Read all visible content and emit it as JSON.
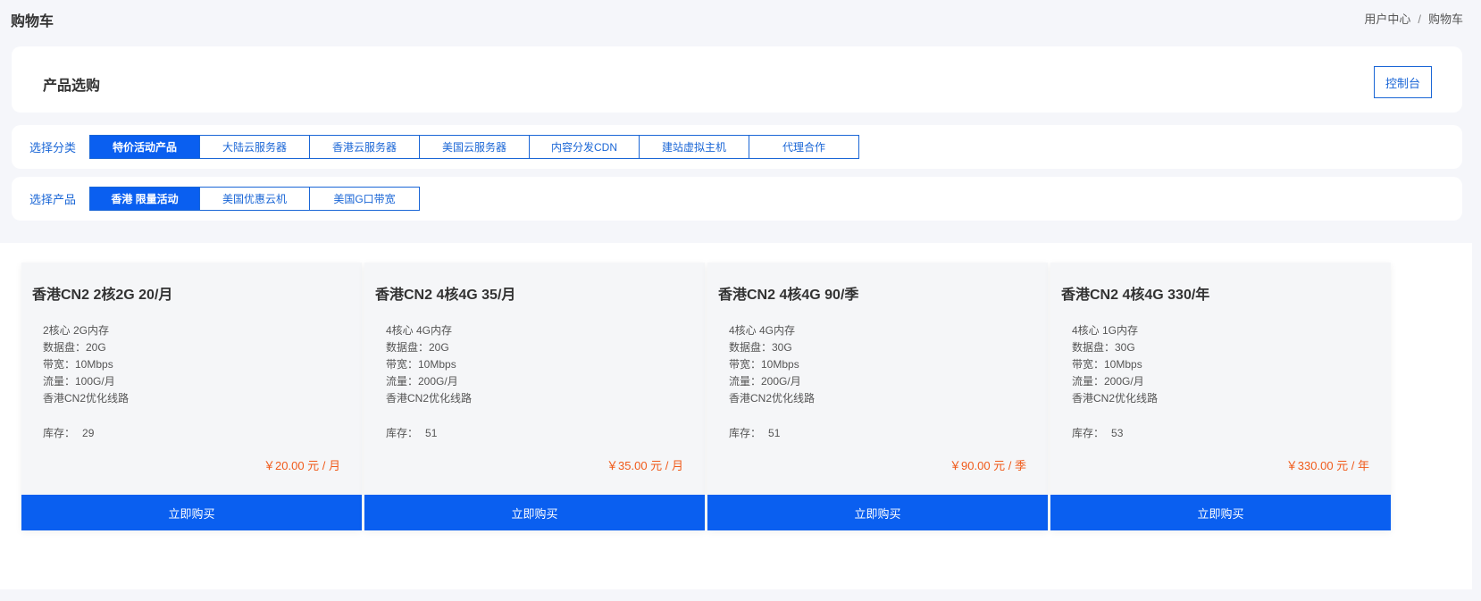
{
  "header": {
    "title": "购物车",
    "breadcrumb": [
      "用户中心",
      "/",
      "购物车"
    ]
  },
  "purchase": {
    "title": "产品选购",
    "console_label": "控制台"
  },
  "category_filter": {
    "label": "选择分类",
    "tabs": [
      "特价活动产品",
      "大陆云服务器",
      "香港云服务器",
      "美国云服务器",
      "内容分发CDN",
      "建站虚拟主机",
      "代理合作"
    ],
    "active_index": 0
  },
  "product_filter": {
    "label": "选择产品",
    "tabs": [
      "香港 限量活动",
      "美国优惠云机",
      "美国G口带宽"
    ],
    "active_index": 0
  },
  "products": [
    {
      "name": "香港CN2 2核2G 20/月",
      "specs": [
        "2核心 2G内存",
        "数据盘：20G",
        "带宽：10Mbps",
        "流量：100G/月",
        "香港CN2优化线路"
      ],
      "stock_label": "库存：",
      "stock": "29",
      "price": "￥20.00 元 / 月",
      "buy_label": "立即购买"
    },
    {
      "name": "香港CN2 4核4G 35/月",
      "specs": [
        "4核心 4G内存",
        "数据盘：20G",
        "带宽：10Mbps",
        "流量：200G/月",
        "香港CN2优化线路"
      ],
      "stock_label": "库存：",
      "stock": "51",
      "price": "￥35.00 元 / 月",
      "buy_label": "立即购买"
    },
    {
      "name": "香港CN2 4核4G 90/季",
      "specs": [
        "4核心 4G内存",
        "数据盘：30G",
        "带宽：10Mbps",
        "流量：200G/月",
        "香港CN2优化线路"
      ],
      "stock_label": "库存：",
      "stock": "51",
      "price": "￥90.00 元 / 季",
      "buy_label": "立即购买"
    },
    {
      "name": "香港CN2 4核4G 330/年",
      "specs": [
        "4核心 1G内存",
        "数据盘：30G",
        "带宽：10Mbps",
        "流量：200G/月",
        "香港CN2优化线路"
      ],
      "stock_label": "库存：",
      "stock": "53",
      "price": "￥330.00 元 / 年",
      "buy_label": "立即购买"
    }
  ],
  "colors": {
    "accent": "#0a5ff0",
    "link": "#1a66d6",
    "price": "#f05a1a",
    "background": "#f5f6fa"
  }
}
